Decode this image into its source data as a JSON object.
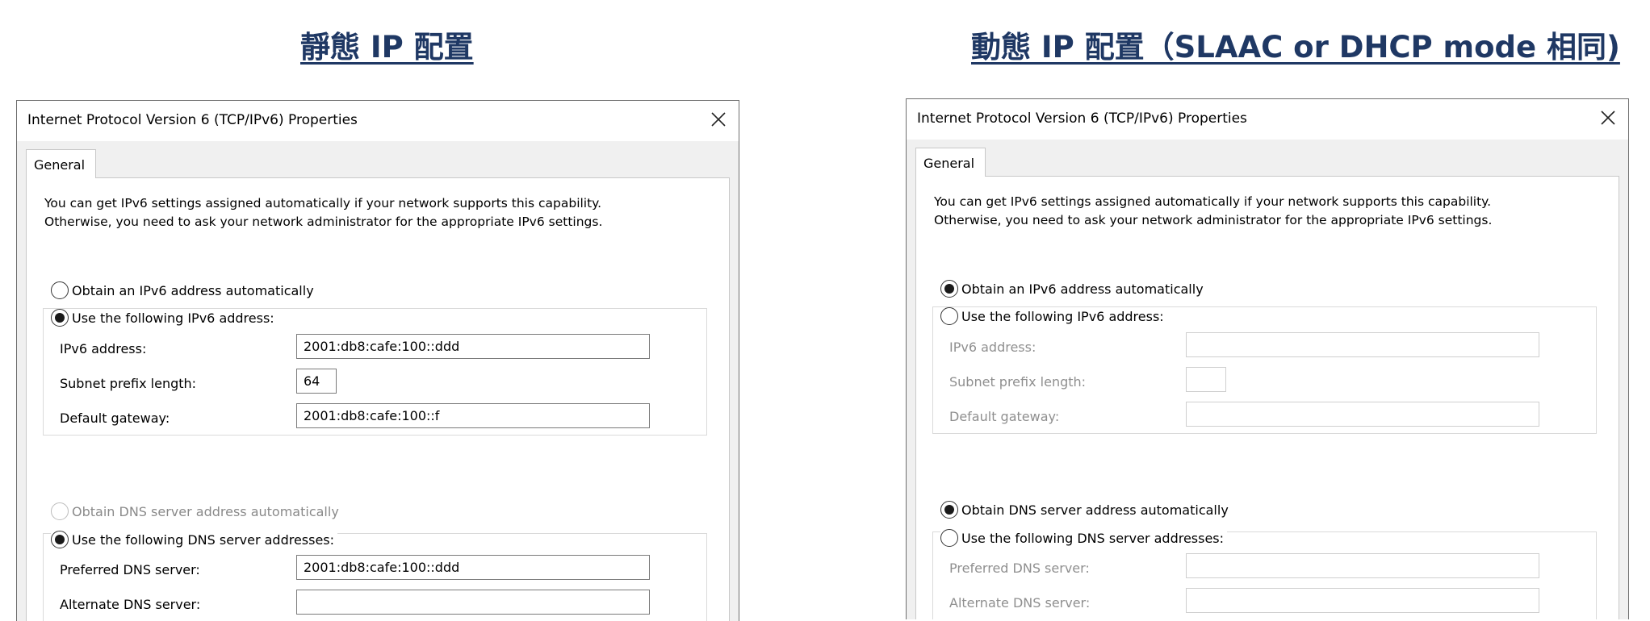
{
  "headings": {
    "static": "靜態 IP 配置",
    "dynamic": "動態 IP 配置（SLAAC or DHCP mode 相同)"
  },
  "dialog": {
    "title": "Internet Protocol Version 6 (TCP/IPv6) Properties",
    "tab_label": "General",
    "intro_line1": "You can get IPv6 settings assigned automatically if your network supports this capability.",
    "intro_line2": "Otherwise, you need to ask your network administrator for the appropriate IPv6 settings.",
    "radio_obtain_ip": "Obtain an IPv6 address automatically",
    "radio_use_ip": "Use the following IPv6 address:",
    "label_ipv6_address": "IPv6 address:",
    "label_prefix_length": "Subnet prefix length:",
    "label_gateway": "Default gateway:",
    "radio_obtain_dns": "Obtain DNS server address automatically",
    "radio_use_dns": "Use the following DNS server addresses:",
    "label_preferred_dns": "Preferred DNS server:",
    "label_alternate_dns": "Alternate DNS server:"
  },
  "static_dialog": {
    "ipv6_address": "2001:db8:cafe:100::ddd",
    "prefix_length": "64",
    "gateway": "2001:db8:cafe:100::f",
    "preferred_dns": "2001:db8:cafe:100::ddd",
    "alternate_dns": "",
    "selected_ip_mode": "Use the following IPv6 address:",
    "selected_dns_mode": "Use the following DNS server addresses:"
  },
  "dynamic_dialog": {
    "ipv6_address": "",
    "prefix_length": "",
    "gateway": "",
    "preferred_dns": "",
    "alternate_dns": "",
    "selected_ip_mode": "Obtain an IPv6 address automatically",
    "selected_dns_mode": "Obtain DNS server address automatically"
  },
  "colors": {
    "heading": "#1f3864",
    "disabled_text": "#8a8a8a"
  },
  "icons": {
    "close": "close-icon",
    "radio": "radio-button"
  }
}
